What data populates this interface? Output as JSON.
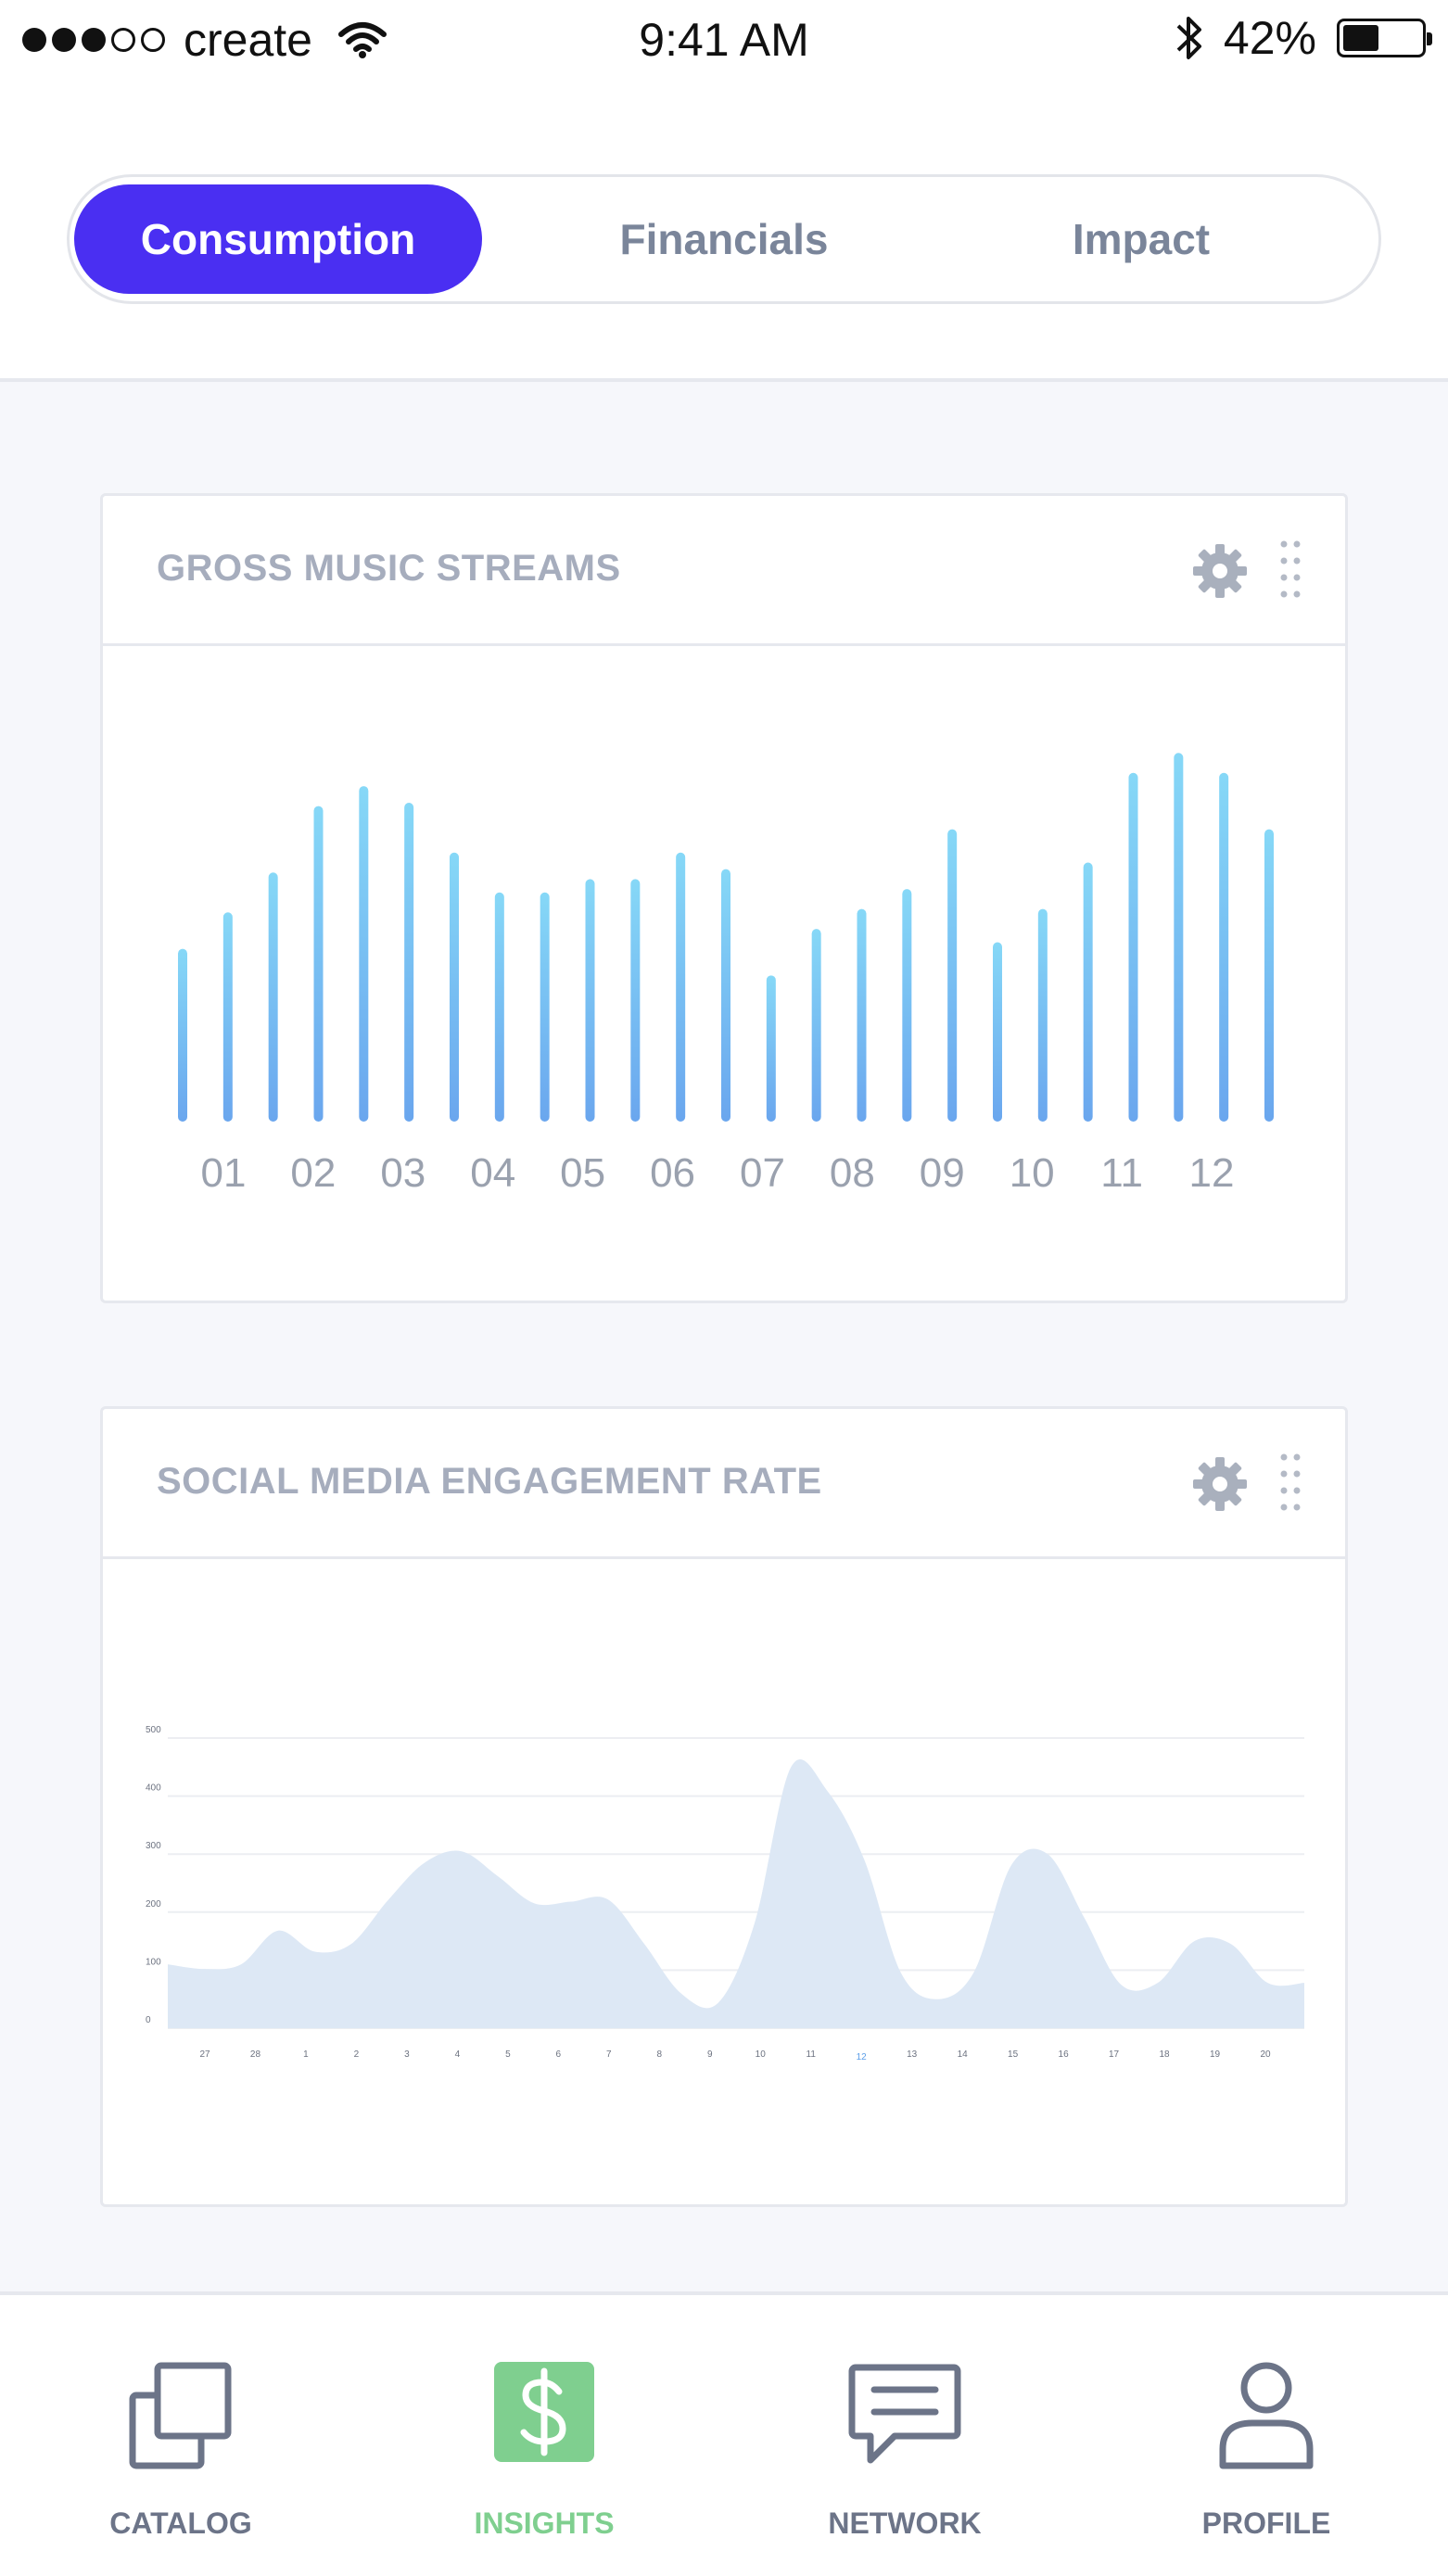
{
  "status_bar": {
    "carrier": "create",
    "time": "9:41 AM",
    "battery": "42%",
    "battery_level": 0.42
  },
  "segments": [
    {
      "label": "Consumption",
      "active": true
    },
    {
      "label": "Financials",
      "active": false
    },
    {
      "label": "Impact",
      "active": false
    }
  ],
  "cards": {
    "streams": {
      "title": "GROSS MUSIC STREAMS",
      "settings_icon": "gear-icon",
      "drag_icon": "drag-handle-icon"
    },
    "social": {
      "title": "SOCIAL MEDIA ENGAGEMENT RATE",
      "settings_icon": "gear-icon",
      "drag_icon": "drag-handle-icon"
    }
  },
  "tabbar": {
    "items": [
      {
        "label": "CATALOG",
        "icon": "catalog-icon",
        "active": false
      },
      {
        "label": "INSIGHTS",
        "icon": "dollar-icon",
        "active": true
      },
      {
        "label": "NETWORK",
        "icon": "chat-icon",
        "active": false
      },
      {
        "label": "PROFILE",
        "icon": "user-icon",
        "active": false
      }
    ]
  },
  "colors": {
    "accent": "#4a2ff2",
    "active_tab": "#7fcf8f",
    "bar_top": "#86d8f7",
    "bar_bottom": "#6aa6ee",
    "area_fill": "#dde8f5",
    "tick_highlight": "#5b9ee8"
  },
  "chart_data": [
    {
      "type": "bar",
      "title": "GROSS MUSIC STREAMS",
      "categories": [
        "01",
        "02",
        "03",
        "04",
        "05",
        "06",
        "07",
        "08",
        "09",
        "10",
        "11",
        "12"
      ],
      "values": [
        52,
        63,
        75,
        95,
        101,
        96,
        81,
        69,
        69,
        73,
        73,
        81,
        76,
        44,
        58,
        64,
        70,
        88,
        54,
        64,
        78,
        105,
        111,
        105,
        88
      ],
      "ylim": [
        0,
        120
      ],
      "grid": false
    },
    {
      "type": "area",
      "title": "SOCIAL MEDIA ENGAGEMENT RATE",
      "x_ticks": [
        "27",
        "28",
        "1",
        "2",
        "3",
        "4",
        "5",
        "6",
        "7",
        "8",
        "9",
        "10",
        "11",
        "12",
        "13",
        "14",
        "15",
        "16",
        "17",
        "18",
        "19",
        "20"
      ],
      "highlighted_tick": "12",
      "y_ticks": [
        "0",
        "100",
        "200",
        "300",
        "400",
        "500"
      ],
      "ylim": [
        0,
        500
      ],
      "grid": true,
      "values": [
        110,
        102,
        110,
        168,
        132,
        145,
        220,
        285,
        305,
        262,
        215,
        218,
        222,
        145,
        60,
        43,
        180,
        450,
        408,
        290,
        95,
        50,
        98,
        280,
        300,
        190,
        75,
        78,
        150,
        145,
        78,
        78
      ]
    }
  ]
}
